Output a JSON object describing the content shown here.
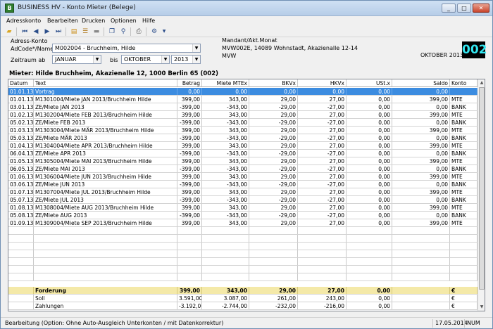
{
  "window": {
    "title": "BUSINESS HV - Konto Mieter (Belege)",
    "app_icon_letter": "B",
    "min": "_",
    "max": "□",
    "close": "✕"
  },
  "menu": [
    "Adresskonto",
    "Bearbeiten",
    "Drucken",
    "Optionen",
    "Hilfe"
  ],
  "form": {
    "group_label": "Adress-Konto",
    "adcode_label": "AdCode*/Name",
    "adcode_value": "M002004 - Bruchheim, Hilde",
    "zeitraum_label": "Zeitraum ab",
    "from_month": "JANUAR",
    "bis_label": "bis",
    "to_month": "OKTOBER",
    "year": "2013"
  },
  "mandant": {
    "label": "Mandant/Akt.Monat",
    "line1": "MVW002E, 14089 Wohnstadt, Akazienalle 12-14",
    "line2": "MVW",
    "month": "OKTOBER 2013",
    "number": "002"
  },
  "tenant_title": "Mieter: Hilde Bruchheim, Akazienalle 12, 1000 Berlin 65 (002)",
  "table": {
    "columns": [
      "Datum",
      "Text",
      "Betrag",
      "Miete MTEx",
      "BKVx",
      "HKVx",
      "USt.x",
      "Saldo",
      "Konto"
    ],
    "rows": [
      [
        "01.01.13",
        "Vortrag",
        "0,00",
        "0,00",
        "0,00",
        "0,00",
        "0,00",
        "0,00",
        ""
      ],
      [
        "01.01.13",
        "M1301004/Miete JAN 2013/Bruchheim Hilde",
        "399,00",
        "343,00",
        "29,00",
        "27,00",
        "0,00",
        "399,00",
        "MTE"
      ],
      [
        "03.01.13",
        "ZE/Miete JAN 2013",
        "-399,00",
        "-343,00",
        "-29,00",
        "-27,00",
        "0,00",
        "0,00",
        "BANK"
      ],
      [
        "01.02.13",
        "M1302004/Miete FEB 2013/Bruchheim Hilde",
        "399,00",
        "343,00",
        "29,00",
        "27,00",
        "0,00",
        "399,00",
        "MTE"
      ],
      [
        "05.02.13",
        "ZE/Miete FEB 2013",
        "-399,00",
        "-343,00",
        "-29,00",
        "-27,00",
        "0,00",
        "0,00",
        "BANK"
      ],
      [
        "01.03.13",
        "M1303004/Miete MÄR 2013/Bruchheim Hilde",
        "399,00",
        "343,00",
        "29,00",
        "27,00",
        "0,00",
        "399,00",
        "MTE"
      ],
      [
        "05.03.13",
        "ZE/Miete MÄR 2013",
        "-399,00",
        "-343,00",
        "-29,00",
        "-27,00",
        "0,00",
        "0,00",
        "BANK"
      ],
      [
        "01.04.13",
        "M1304004/Miete APR 2013/Bruchheim Hilde",
        "399,00",
        "343,00",
        "29,00",
        "27,00",
        "0,00",
        "399,00",
        "MTE"
      ],
      [
        "06.04.13",
        "ZE/Miete APR 2013",
        "-399,00",
        "-343,00",
        "-29,00",
        "-27,00",
        "0,00",
        "0,00",
        "BANK"
      ],
      [
        "01.05.13",
        "M1305004/Miete MAI 2013/Bruchheim Hilde",
        "399,00",
        "343,00",
        "29,00",
        "27,00",
        "0,00",
        "399,00",
        "MTE"
      ],
      [
        "06.05.13",
        "ZE/Miete MAI 2013",
        "-399,00",
        "-343,00",
        "-29,00",
        "-27,00",
        "0,00",
        "0,00",
        "BANK"
      ],
      [
        "01.06.13",
        "M1306004/Miete JUN 2013/Bruchheim Hilde",
        "399,00",
        "343,00",
        "29,00",
        "27,00",
        "0,00",
        "399,00",
        "MTE"
      ],
      [
        "03.06.13",
        "ZE/Miete JUN 2013",
        "-399,00",
        "-343,00",
        "-29,00",
        "-27,00",
        "0,00",
        "0,00",
        "BANK"
      ],
      [
        "01.07.13",
        "M1307004/Miete JUL 2013/Bruchheim Hilde",
        "399,00",
        "343,00",
        "29,00",
        "27,00",
        "0,00",
        "399,00",
        "MTE"
      ],
      [
        "05.07.13",
        "ZE/Miete JUL 2013",
        "-399,00",
        "-343,00",
        "-29,00",
        "-27,00",
        "0,00",
        "0,00",
        "BANK"
      ],
      [
        "01.08.13",
        "M1308004/Miete AUG 2013/Bruchheim Hilde",
        "399,00",
        "343,00",
        "29,00",
        "27,00",
        "0,00",
        "399,00",
        "MTE"
      ],
      [
        "05.08.13",
        "ZE/Miete AUG 2013",
        "-399,00",
        "-343,00",
        "-29,00",
        "-27,00",
        "0,00",
        "0,00",
        "BANK"
      ],
      [
        "01.09.13",
        "M1309004/Miete SEP 2013/Bruchheim Hilde",
        "399,00",
        "343,00",
        "29,00",
        "27,00",
        "0,00",
        "399,00",
        "MTE"
      ]
    ],
    "summary": [
      [
        "",
        "Forderung",
        "399,00",
        "343,00",
        "29,00",
        "27,00",
        "0,00",
        "",
        "€"
      ],
      [
        "",
        "Soll",
        "3.591,00",
        "3.087,00",
        "261,00",
        "243,00",
        "0,00",
        "",
        "€"
      ],
      [
        "",
        "Zahlungen",
        "-3.192,00",
        "-2.744,00",
        "-232,00",
        "-216,00",
        "0,00",
        "",
        "€"
      ]
    ]
  },
  "status": {
    "text": "Bearbeitung (Option: Ohne Auto-Ausgleich Unterkonten / mit Datenkorrektur)",
    "date": "17.05.2014",
    "mode": "NUM"
  },
  "colors": {
    "selected_row": "#3c8ce0",
    "summary_row": "#f4e9a8",
    "mandant_bg": "#000000",
    "mandant_fg": "#33e6f0"
  }
}
